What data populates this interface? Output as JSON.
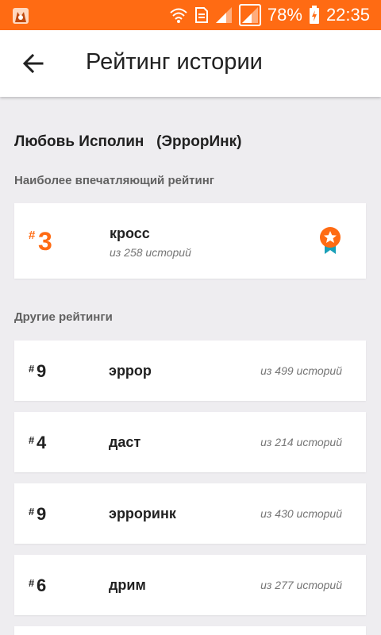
{
  "status_bar": {
    "battery_percent": "78%",
    "time": "22:35",
    "icons": [
      "app-fox-icon",
      "wifi-icon",
      "sim-card-icon",
      "signal-icon",
      "signal-icon",
      "battery-charging-icon"
    ]
  },
  "app_bar": {
    "title": "Рейтинг истории",
    "back_icon": "arrow-left-icon"
  },
  "story": {
    "title": "Любовь Исполин   (ЭррорИнк)"
  },
  "featured": {
    "label": "Наиболее впечатляющий рейтинг",
    "hash": "#",
    "rank": "3",
    "tag": "кросс",
    "out_of": "из 258 историй",
    "icon": "medal-star-icon"
  },
  "other": {
    "label": "Другие рейтинги",
    "items": [
      {
        "hash": "#",
        "rank": "9",
        "tag": "эррор",
        "out_of": "из 499 историй"
      },
      {
        "hash": "#",
        "rank": "4",
        "tag": "даст",
        "out_of": "из 214 историй"
      },
      {
        "hash": "#",
        "rank": "9",
        "tag": "эрроринк",
        "out_of": "из 430 историй"
      },
      {
        "hash": "#",
        "rank": "6",
        "tag": "дрим",
        "out_of": "из 277 историй"
      }
    ]
  },
  "colors": {
    "accent": "#ff6b13",
    "background": "#eeedf0",
    "card": "#ffffff",
    "medal_ribbon": "#1aa0b8"
  }
}
